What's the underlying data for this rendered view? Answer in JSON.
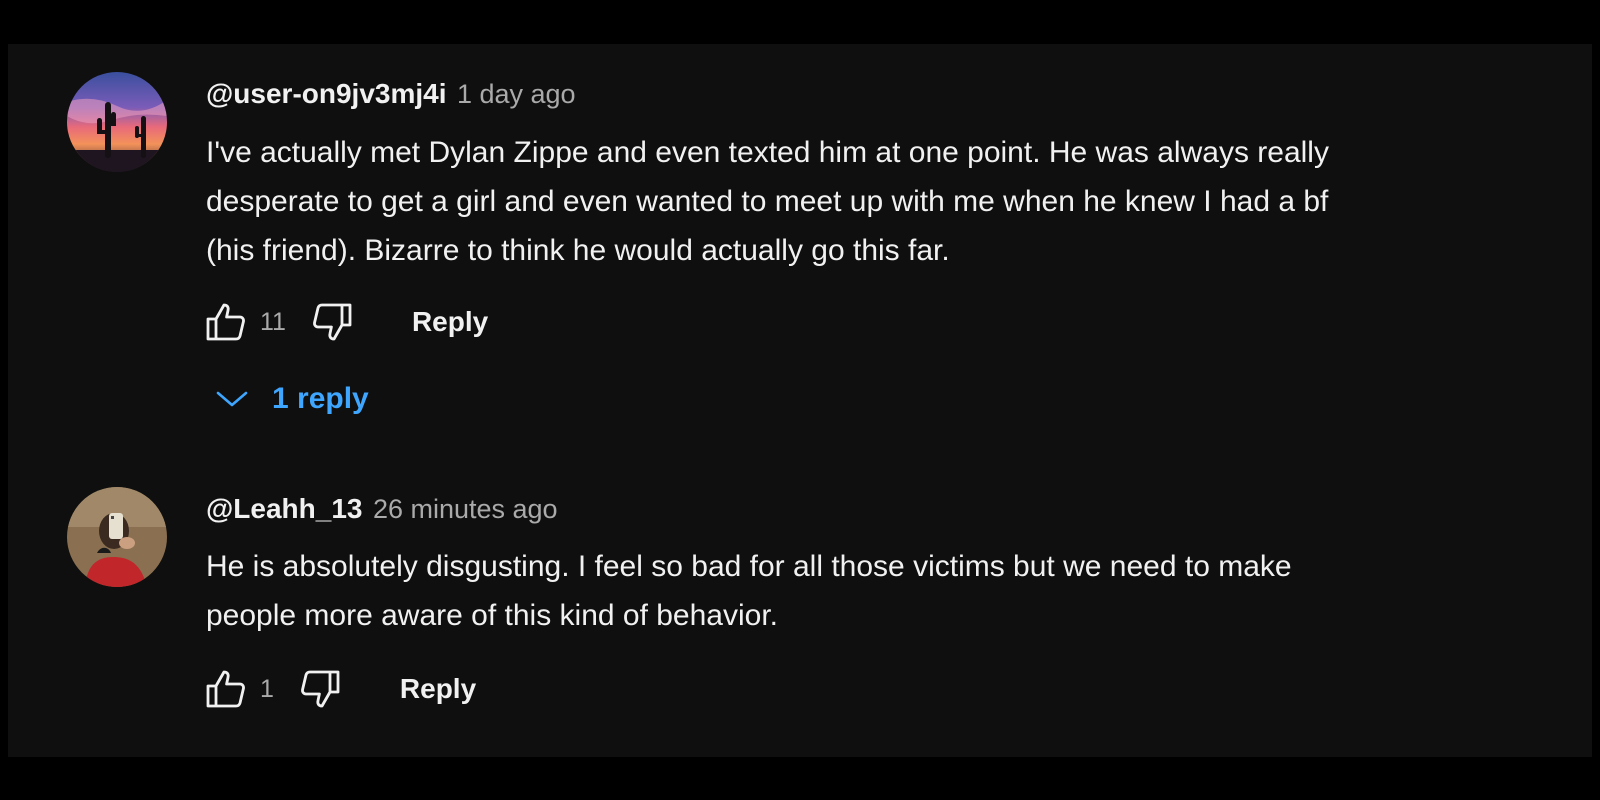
{
  "colors": {
    "background": "#0f0f0f",
    "outer": "#000000",
    "text_primary": "#f1f1f1",
    "text_secondary": "#aaaaaa",
    "link_blue": "#3ea6ff"
  },
  "comments": [
    {
      "author": "@user-on9jv3mj4i",
      "time": "1 day ago",
      "text_lines": [
        "I've actually met Dylan Zippe and even texted him at one point. He was always really",
        "desperate to get a girl and even wanted to meet up with me when he knew I had a bf",
        "(his friend). Bizarre to think he would actually go this far."
      ],
      "like_count": "11",
      "reply_label": "Reply",
      "replies_toggle": "1 reply",
      "avatar": "desert-sunset-cactus-avatar",
      "icons": [
        "thumbs-up-icon",
        "thumbs-down-icon",
        "chevron-down-icon"
      ]
    },
    {
      "author": "@Leahh_13",
      "time": "26 minutes ago",
      "text_lines": [
        "He is absolutely disgusting. I feel so bad for all those victims but we need to make",
        "people more aware of this kind of behavior."
      ],
      "like_count": "1",
      "reply_label": "Reply",
      "avatar": "mirror-selfie-avatar",
      "icons": [
        "thumbs-up-icon",
        "thumbs-down-icon"
      ]
    }
  ]
}
